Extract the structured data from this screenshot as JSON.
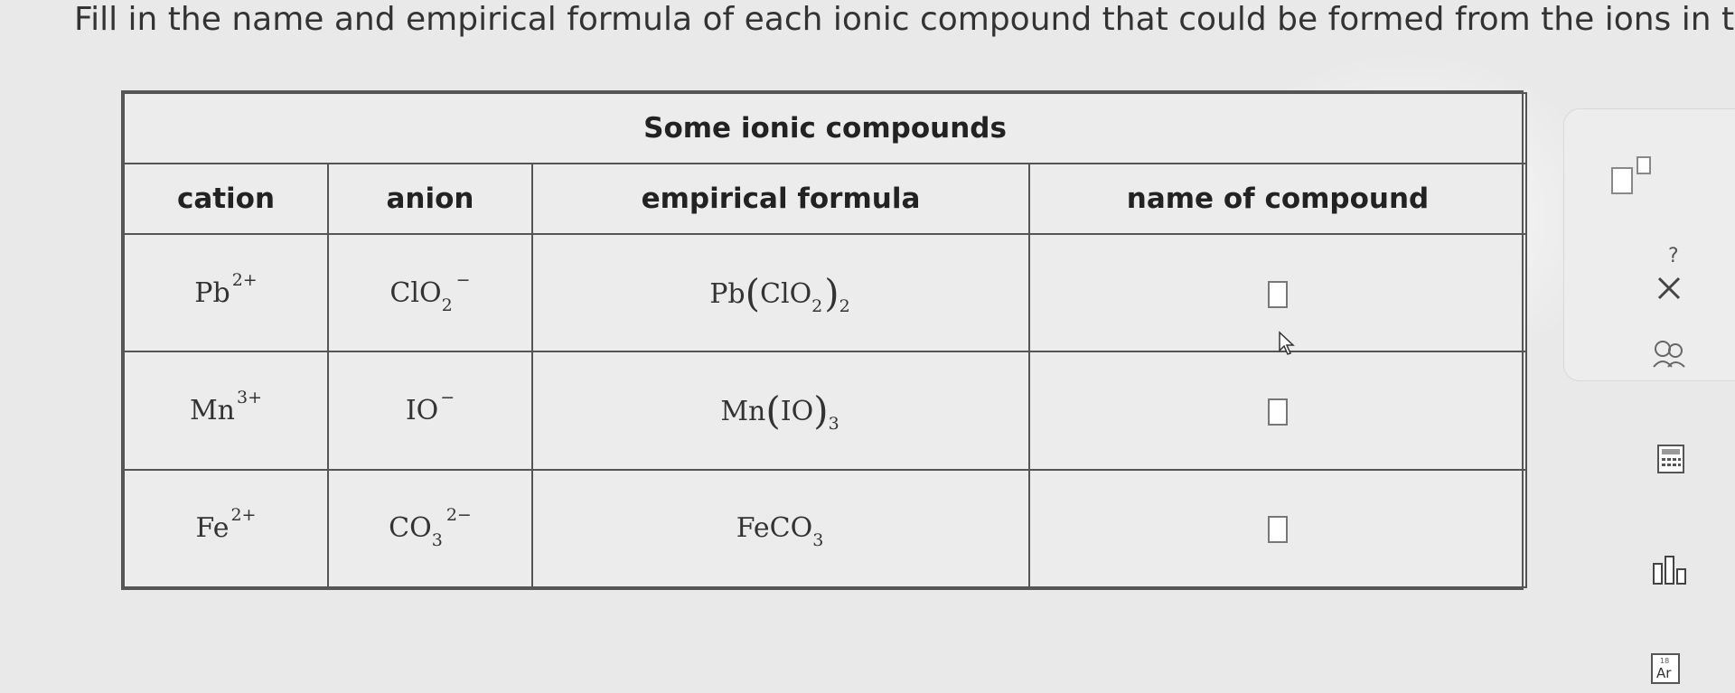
{
  "prompt": "Fill in the name and empirical formula of each ionic compound that could be formed from the ions in this",
  "table": {
    "title": "Some ionic compounds",
    "headers": {
      "cation": "cation",
      "anion": "anion",
      "formula": "empirical formula",
      "name": "name of compound"
    },
    "rows": [
      {
        "cation": {
          "symbol": "Pb",
          "charge": "2+"
        },
        "anion": {
          "symbol": "ClO",
          "subscript": "2",
          "charge": "−"
        },
        "formula": {
          "a": "Pb",
          "open": "(",
          "ion": "ClO",
          "ion_sub": "2",
          "close": ")",
          "sub": "2"
        },
        "name": ""
      },
      {
        "cation": {
          "symbol": "Mn",
          "charge": "3+"
        },
        "anion": {
          "symbol": "IO",
          "subscript": "",
          "charge": "−"
        },
        "formula": {
          "a": "Mn",
          "open": "(",
          "ion": "IO",
          "ion_sub": "",
          "close": ")",
          "sub": "3"
        },
        "name": ""
      },
      {
        "cation": {
          "symbol": "Fe",
          "charge": "2+"
        },
        "anion": {
          "symbol": "CO",
          "subscript": "3",
          "charge": "2−"
        },
        "formula": {
          "a": "FeCO",
          "sub": "3"
        },
        "name": ""
      }
    ]
  },
  "toolbar": {
    "superscript_icon": "superscript-template-icon",
    "clear_icon": "x-clear-icon",
    "undo_label": "?",
    "help_icon": "explanation-icon",
    "calculator_icon": "calculator-icon",
    "chart_icon": "data-chart-icon",
    "periodic_table_label": "Ar",
    "periodic_table_number": "18"
  },
  "colors": {
    "background": "#e9e9e9",
    "border": "#555555"
  }
}
